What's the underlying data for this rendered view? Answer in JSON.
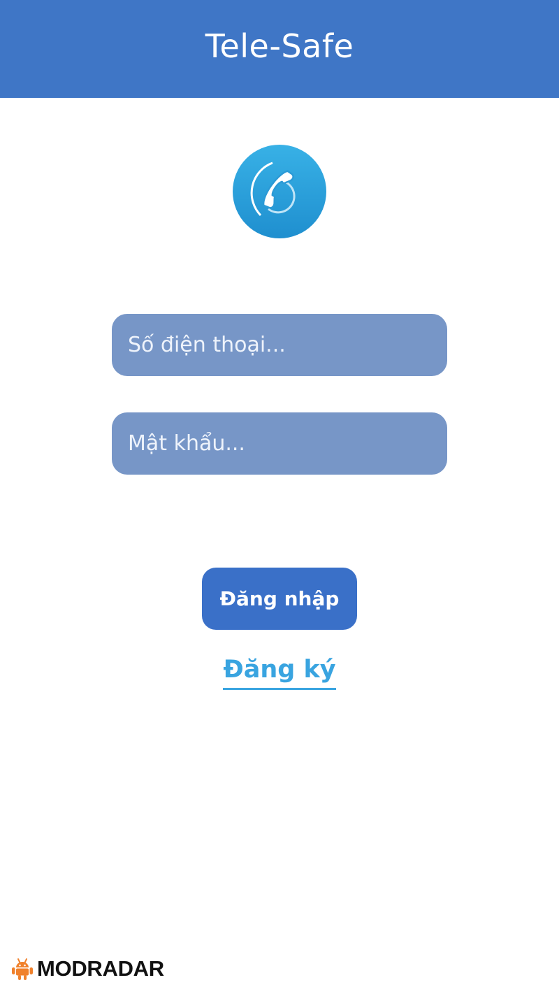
{
  "header": {
    "title": "Tele-Safe",
    "background_color": "#3f76c6"
  },
  "logo": {
    "icon": "phone-icon",
    "color": "#27a0dc"
  },
  "form": {
    "phone_placeholder": "Số điện thoại...",
    "password_placeholder": "Mật khẩu...",
    "field_color": "#7796c7"
  },
  "actions": {
    "login_label": "Đăng nhập",
    "login_color": "#3a70c8",
    "register_label": "Đăng ký",
    "register_color": "#39a4e0"
  },
  "watermark": {
    "text": "MODRADAR",
    "icon": "android-icon",
    "icon_color": "#f0812c"
  }
}
